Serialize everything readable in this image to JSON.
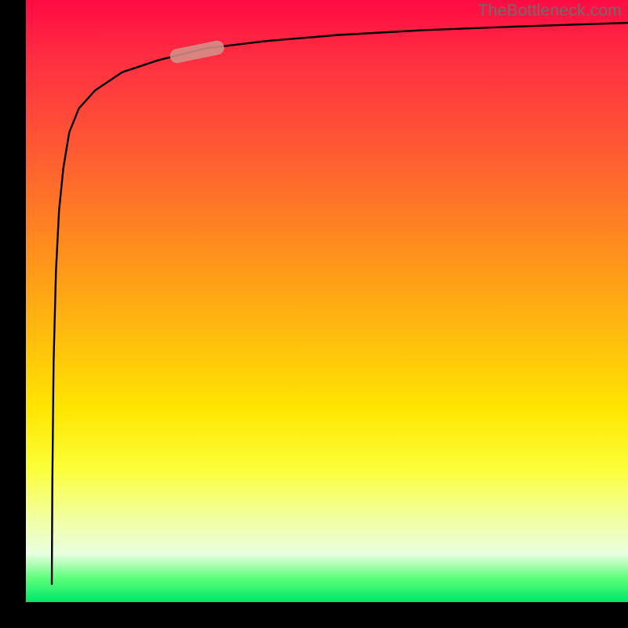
{
  "watermark": "TheBottleneck.com",
  "chart_data": {
    "type": "line",
    "title": "",
    "xlabel": "",
    "ylabel": "",
    "xlim": [
      0,
      100
    ],
    "ylim": [
      0,
      100
    ],
    "grid": false,
    "legend": false,
    "series": [
      {
        "name": "curve",
        "x": [
          4.3,
          4.4,
          4.6,
          5.0,
          5.5,
          6.2,
          7.2,
          8.8,
          11.5,
          16,
          22,
          30,
          40,
          52,
          66,
          82,
          100
        ],
        "values": [
          3.0,
          20,
          40,
          55,
          65,
          72,
          78,
          82,
          85,
          88,
          90,
          92,
          93.2,
          94.2,
          95,
          95.6,
          96.2
        ]
      }
    ],
    "annotations": [
      {
        "name": "highlight-segment",
        "x_range": [
          24,
          33
        ],
        "y_range": [
          79.5,
          83.5
        ]
      }
    ],
    "background_gradient": [
      "#ff0b43",
      "#ff8a1e",
      "#ffe600",
      "#00e56a"
    ]
  },
  "colors": {
    "curve": "#000000",
    "highlight": "#d59189",
    "watermark": "#6c6c6c"
  }
}
